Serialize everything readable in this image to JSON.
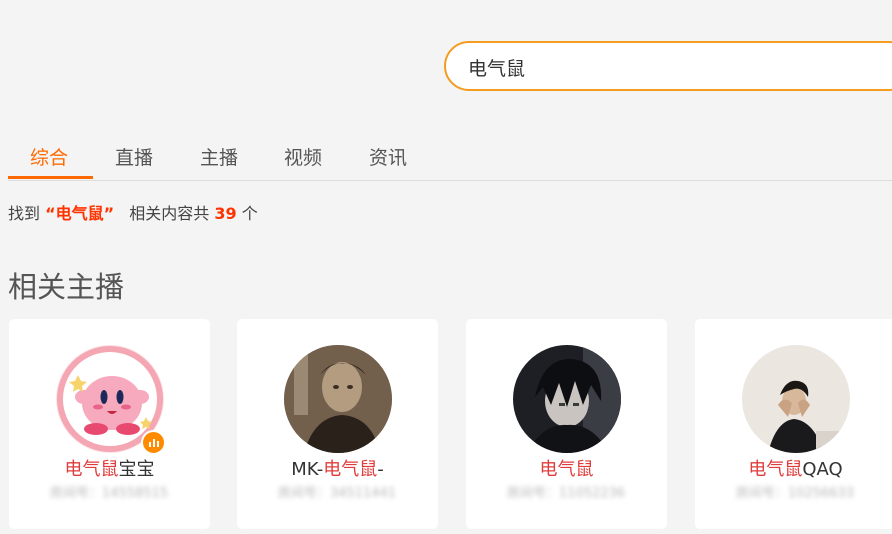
{
  "search": {
    "value": "电气鼠"
  },
  "tabs": [
    {
      "label": "综合",
      "active": true
    },
    {
      "label": "直播",
      "active": false
    },
    {
      "label": "主播",
      "active": false
    },
    {
      "label": "视频",
      "active": false
    },
    {
      "label": "资讯",
      "active": false
    }
  ],
  "summary": {
    "prefix": "找到",
    "keyword": "“电气鼠”",
    "middle": "相关内容共",
    "count": "39",
    "suffix": "个"
  },
  "section": {
    "title": "相关主播"
  },
  "anchors": [
    {
      "name_highlight": "电气鼠",
      "name_rest": "宝宝",
      "name_prefix": "",
      "room": "房间号：14558515",
      "live": true,
      "avatar_icon": "pink-cartoon-avatar"
    },
    {
      "name_prefix": "MK-",
      "name_highlight": "电气鼠",
      "name_rest": "-",
      "room": "房间号：34511441",
      "live": false,
      "avatar_icon": "sepia-portrait-avatar"
    },
    {
      "name_prefix": "",
      "name_highlight": "电气鼠",
      "name_rest": "",
      "room": "房间号：11052236",
      "live": false,
      "avatar_icon": "dark-anime-avatar"
    },
    {
      "name_prefix": "",
      "name_highlight": "电气鼠",
      "name_rest": "QAQ",
      "room": "房间号：10256633",
      "live": false,
      "avatar_icon": "light-portrait-avatar"
    }
  ],
  "colors": {
    "accent": "#ff6a00",
    "search_border": "#f39c1f",
    "highlight": "#e03c3c",
    "count": "#ff3300"
  }
}
